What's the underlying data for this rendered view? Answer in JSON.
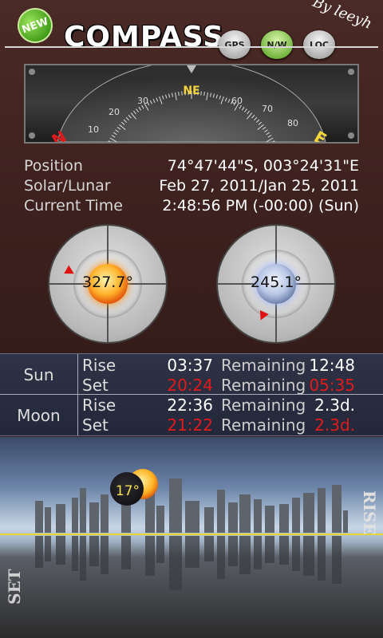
{
  "app": {
    "title": "COMPASS",
    "badge": "NEW",
    "signature": "By leeyh"
  },
  "toolbar": {
    "gps_label": "GPS",
    "nw_label": "N/W",
    "loc_label": "LOC"
  },
  "compass": {
    "heading_label": "NE",
    "tick_labels": [
      "10",
      "20",
      "30",
      "60",
      "70",
      "80"
    ],
    "left_letter": "N",
    "right_letter": "E"
  },
  "info": {
    "position_label": "Position",
    "position_value": "74°47'44\"S, 003°24'31\"E",
    "solar_lunar_label": "Solar/Lunar",
    "solar_lunar_value": "Feb 27, 2011/Jan 25, 2011",
    "time_label": "Current Time",
    "time_value": "2:48:56 PM (-00:00) (Sun)"
  },
  "gauges": {
    "sun_azimuth": "327.7°",
    "moon_azimuth": "245.1°"
  },
  "times": {
    "sun": {
      "name": "Sun",
      "rise_label": "Rise",
      "rise_time": "03:37",
      "rise_remaining_label": "Remaining",
      "rise_remaining": "12:48",
      "set_label": "Set",
      "set_time": "20:24",
      "set_remaining_label": "Remaining",
      "set_remaining": "05:35"
    },
    "moon": {
      "name": "Moon",
      "rise_label": "Rise",
      "rise_time": "22:36",
      "rise_remaining_label": "Remaining",
      "rise_remaining": "2.3d.",
      "set_label": "Set",
      "set_time": "21:22",
      "set_remaining_label": "Remaining",
      "set_remaining": "2.3d."
    }
  },
  "scene": {
    "temperature": "17°",
    "set_label": "SET",
    "rise_label": "RISE"
  },
  "colors": {
    "accent_red": "#e21a1a",
    "horizon": "#e8d62a",
    "heading_yellow": "#f3d53a"
  }
}
